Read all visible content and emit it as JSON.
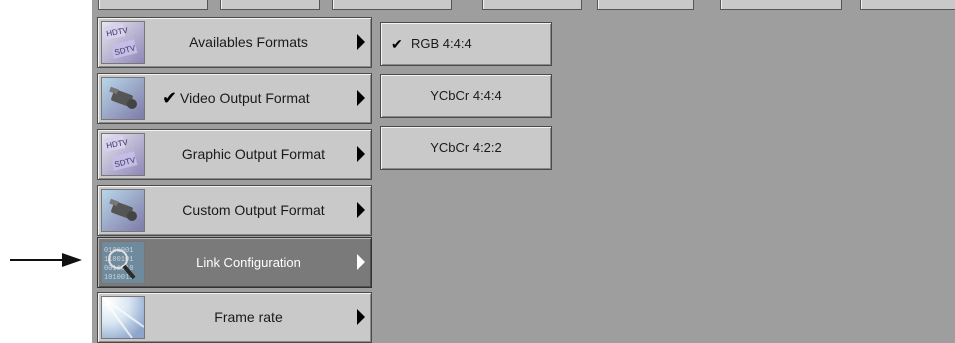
{
  "menu": {
    "items": [
      {
        "label": "Availables Formats",
        "icon": "hdtv-sdtv-icon",
        "checked": false
      },
      {
        "label": "Video Output Format",
        "icon": "video-camera-icon",
        "checked": true
      },
      {
        "label": "Graphic Output Format",
        "icon": "hdtv-sdtv-icon",
        "checked": false
      },
      {
        "label": "Custom Output Format",
        "icon": "video-camera-icon",
        "checked": false
      },
      {
        "label": "Link Configuration",
        "icon": "magnifier-binary-icon",
        "checked": false,
        "active": true
      },
      {
        "label": "Frame rate",
        "icon": "light-rays-icon",
        "checked": false
      }
    ],
    "check_glyph": "✔"
  },
  "submenu": {
    "items": [
      {
        "label": "RGB 4:4:4",
        "selected": true
      },
      {
        "label": "YCbCr 4:4:4",
        "selected": false
      },
      {
        "label": "YCbCr 4:2:2",
        "selected": false
      }
    ],
    "check_glyph": "✔"
  },
  "colors": {
    "panel": "#9e9e9e",
    "button": "#c9c9c9",
    "active_button": "#7a7a7a",
    "active_text": "#ffffff"
  }
}
